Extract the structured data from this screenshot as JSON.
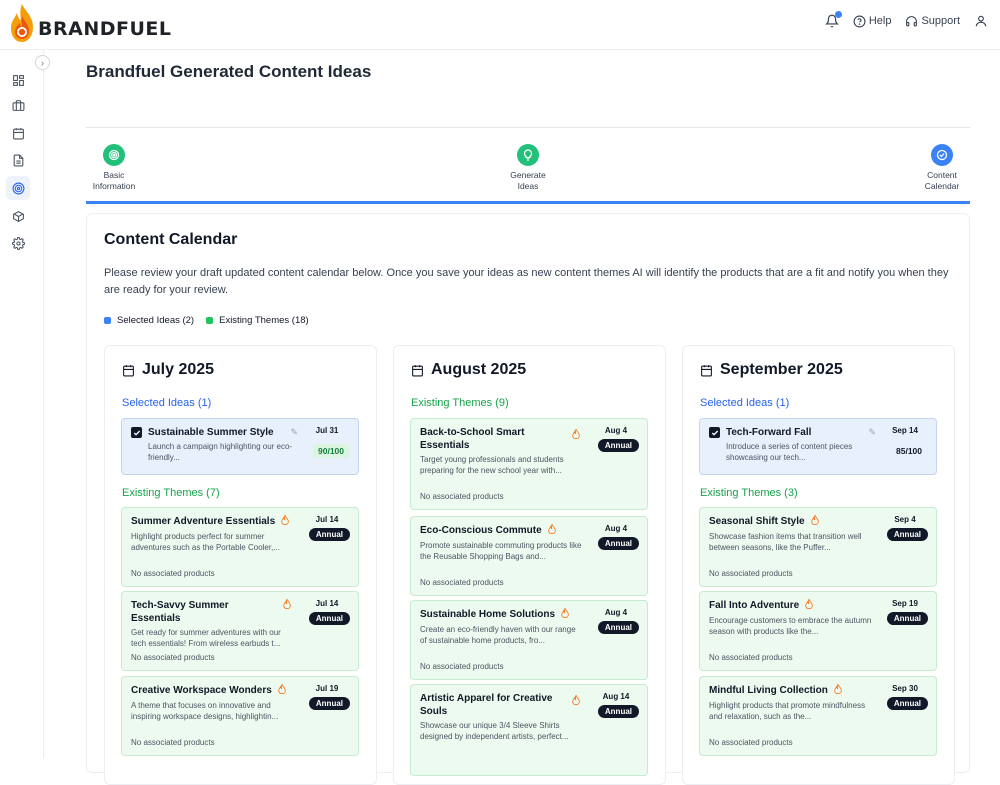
{
  "header": {
    "logo_text": "BRANDFUEL",
    "help_label": "Help",
    "support_label": "Support"
  },
  "sidebar": {
    "items": [
      "dashboard-icon",
      "briefcase-icon",
      "calendar-icon",
      "document-icon",
      "target-icon",
      "box-icon",
      "settings-icon"
    ],
    "active_index": 4
  },
  "page": {
    "title": "Brandfuel Generated Content Ideas"
  },
  "steps": [
    {
      "label_line1": "Basic",
      "label_line2": "Information",
      "color": "#22c07a"
    },
    {
      "label_line1": "Generate",
      "label_line2": "Ideas",
      "color": "#22c07a"
    },
    {
      "label_line1": "Content",
      "label_line2": "Calendar",
      "color": "#3b82f6"
    }
  ],
  "calendar": {
    "title": "Content Calendar",
    "description": "Please review your draft updated content calendar below. Once you save your ideas as new content themes AI will identify the products that are a fit and notify you when they are ready for your review.",
    "legend": {
      "selected": "Selected Ideas (2)",
      "existing": "Existing Themes (18)",
      "selected_color": "#3b82f6",
      "existing_color": "#22c55e"
    },
    "months": [
      {
        "name": "July 2025",
        "selected_header": "Selected Ideas (1)",
        "selected": [
          {
            "title": "Sustainable Summer Style",
            "desc": "Launch a campaign highlighting our eco-friendly...",
            "date": "Jul 31",
            "score": "90/100"
          }
        ],
        "themes_header": "Existing Themes (7)",
        "themes": [
          {
            "title": "Summer Adventure Essentials",
            "desc": "Highlight products perfect for summer adventures such as the Portable Cooler,...",
            "date": "Jul 14",
            "badge": "Annual",
            "products": "No associated products"
          },
          {
            "title": "Tech-Savvy Summer Essentials",
            "desc": "Get ready for summer adventures with our tech essentials! From wireless earbuds t...",
            "date": "Jul 14",
            "badge": "Annual",
            "products": "No associated products"
          },
          {
            "title": "Creative Workspace Wonders",
            "desc": "A theme that focuses on innovative and inspiring workspace designs, highlightin...",
            "date": "Jul 19",
            "badge": "Annual",
            "products": "No associated products"
          }
        ]
      },
      {
        "name": "August 2025",
        "themes_header": "Existing Themes (9)",
        "themes": [
          {
            "title": "Back-to-School Smart Essentials",
            "desc": "Target young professionals and students preparing for the new school year with...",
            "date": "Aug 4",
            "badge": "Annual",
            "products": "No associated products"
          },
          {
            "title": "Eco-Conscious Commute",
            "desc": "Promote sustainable commuting products like the Reusable Shopping Bags and...",
            "date": "Aug 4",
            "badge": "Annual",
            "products": "No associated products"
          },
          {
            "title": "Sustainable Home Solutions",
            "desc": "Create an eco-friendly haven with our range of sustainable home products, fro...",
            "date": "Aug 4",
            "badge": "Annual",
            "products": "No associated products"
          },
          {
            "title": "Artistic Apparel for Creative Souls",
            "desc": "Showcase our unique 3/4 Sleeve Shirts designed by independent artists, perfect...",
            "date": "Aug 14",
            "badge": "Annual",
            "products": ""
          }
        ]
      },
      {
        "name": "September 2025",
        "selected_header": "Selected Ideas (1)",
        "selected": [
          {
            "title": "Tech-Forward Fall",
            "desc": "Introduce a series of content pieces showcasing our tech...",
            "date": "Sep 14",
            "score": "85/100"
          }
        ],
        "themes_header": "Existing Themes (3)",
        "themes": [
          {
            "title": "Seasonal Shift Style",
            "desc": "Showcase fashion items that transition well between seasons, like the Puffer...",
            "date": "Sep 4",
            "badge": "Annual",
            "products": "No associated products"
          },
          {
            "title": "Fall Into Adventure",
            "desc": "Encourage customers to embrace the autumn season with products like the...",
            "date": "Sep 19",
            "badge": "Annual",
            "products": "No associated products"
          },
          {
            "title": "Mindful Living Collection",
            "desc": "Highlight products that promote mindfulness and relaxation, such as the...",
            "date": "Sep 30",
            "badge": "Annual",
            "products": "No associated products"
          }
        ]
      }
    ]
  }
}
